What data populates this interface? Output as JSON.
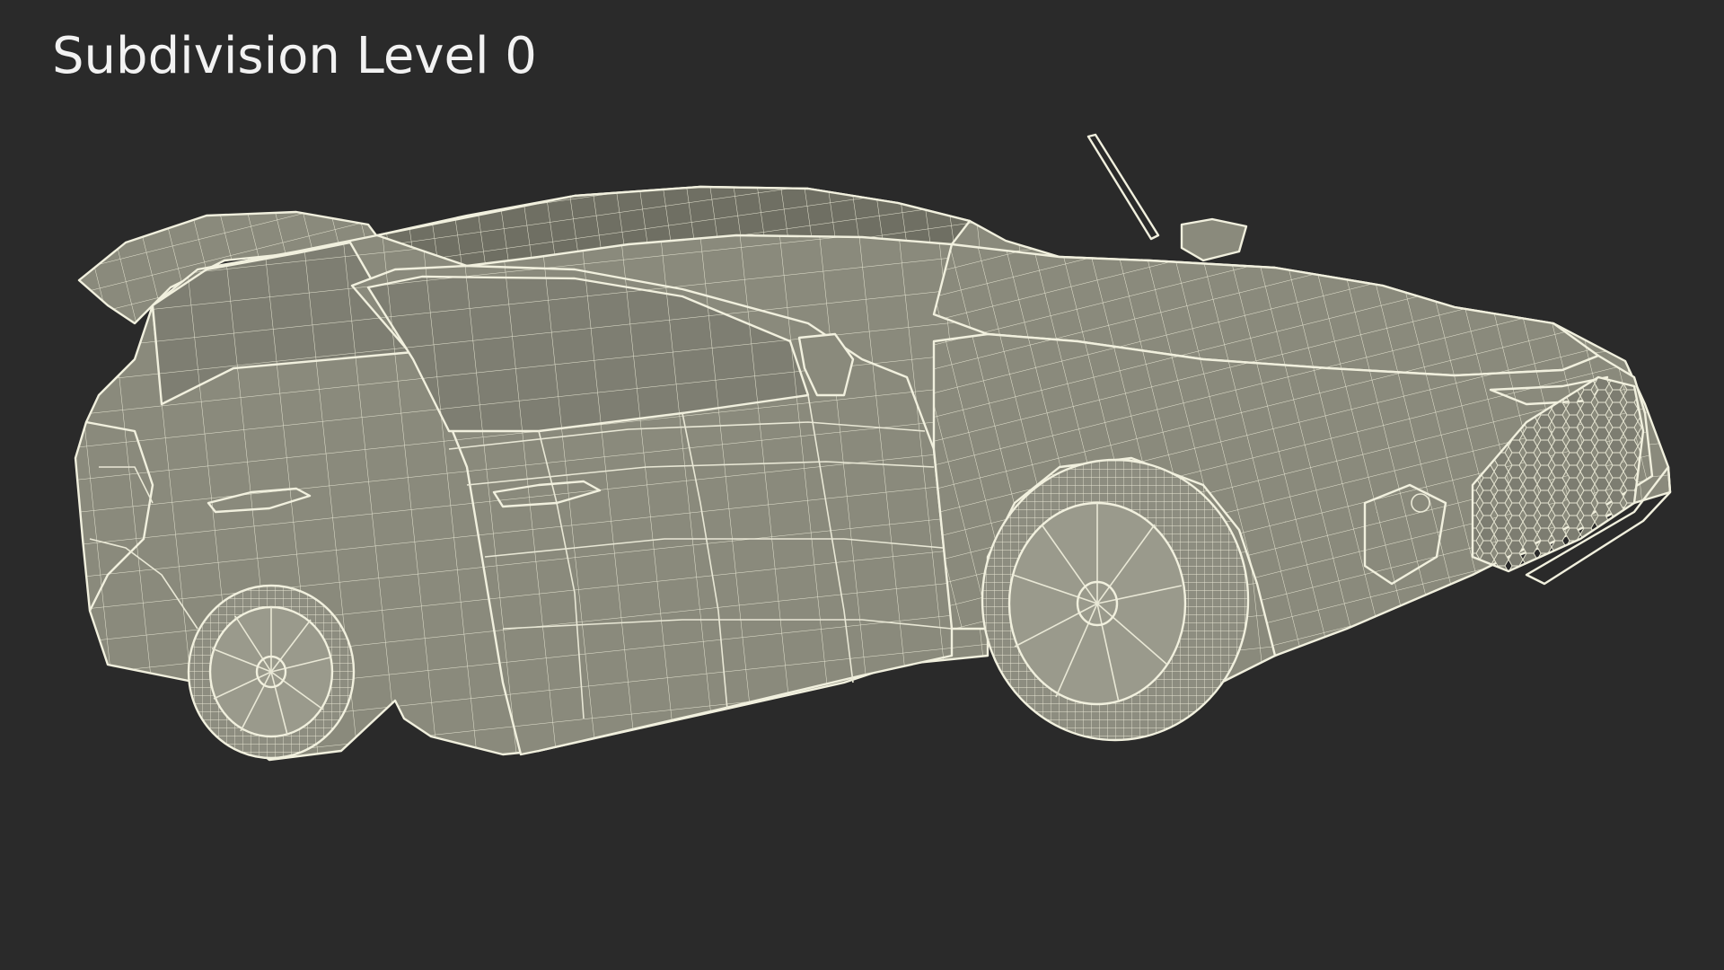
{
  "title": "Subdivision Level 0",
  "colors": {
    "background": "#2a2a2a",
    "model_fill": "#8a8a7c",
    "wireframe": "#e9e8d6",
    "title_text": "#f2f2f2"
  },
  "subject": {
    "icon": "wireframe-car-render"
  }
}
